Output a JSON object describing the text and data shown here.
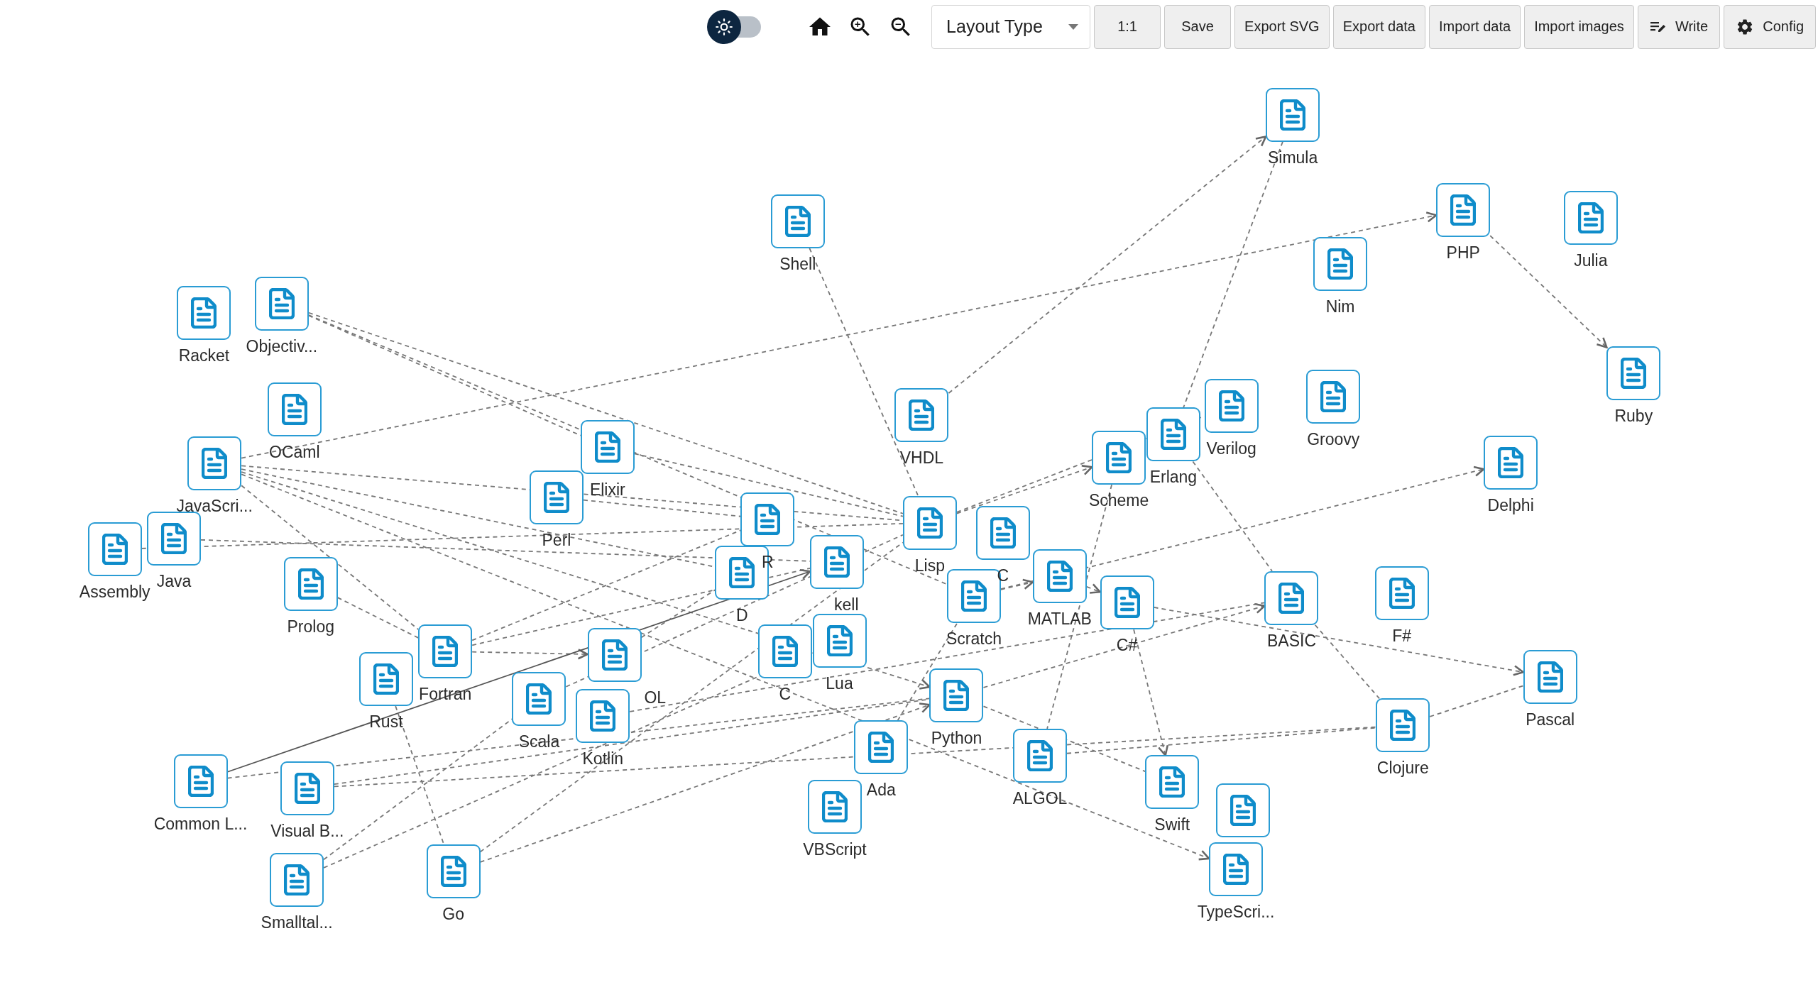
{
  "toolbar": {
    "theme_toggle": {
      "on": false
    },
    "layout_select": {
      "value": "Layout Type"
    },
    "buttons": [
      {
        "label": "1:1",
        "kind": "text"
      },
      {
        "label": "Save",
        "kind": "text"
      },
      {
        "label": "Export SVG",
        "kind": "text"
      },
      {
        "label": "Export data",
        "kind": "text"
      },
      {
        "label": "Import data",
        "kind": "text"
      },
      {
        "label": "Import images",
        "kind": "text"
      },
      {
        "label": "Write",
        "kind": "write"
      },
      {
        "label": "Config",
        "kind": "config"
      }
    ]
  },
  "graph": {
    "nodes": [
      {
        "kind": "document",
        "label": "Simula"
      },
      {
        "kind": "document",
        "label": "Shell"
      },
      {
        "kind": "document",
        "label": "PHP"
      },
      {
        "kind": "document",
        "label": "Julia"
      },
      {
        "kind": "document",
        "label": "Nim"
      },
      {
        "kind": "document",
        "label": "Racket"
      },
      {
        "kind": "document",
        "label": "Objectiv..."
      },
      {
        "kind": "document",
        "label": "Ruby"
      },
      {
        "kind": "document",
        "label": "OCaml"
      },
      {
        "kind": "document",
        "label": "VHDL"
      },
      {
        "kind": "document",
        "label": "Groovy"
      },
      {
        "kind": "document",
        "label": "Verilog"
      },
      {
        "kind": "document",
        "label": "Scheme"
      },
      {
        "kind": "document",
        "label": "Erlang"
      },
      {
        "kind": "document",
        "label": "Delphi"
      },
      {
        "kind": "document",
        "label": "Elixir"
      },
      {
        "kind": "document",
        "label": "Perl"
      },
      {
        "kind": "document",
        "label": "Java"
      },
      {
        "kind": "document",
        "label": "JavaScri..."
      },
      {
        "kind": "document",
        "label": "Assembly"
      },
      {
        "kind": "document",
        "label": "R"
      },
      {
        "kind": "document",
        "label": "Lisp"
      },
      {
        "kind": "document",
        "label": "D"
      },
      {
        "kind": "document",
        "label": "kell"
      },
      {
        "kind": "document",
        "label": "C"
      },
      {
        "kind": "document",
        "label": "Scratch"
      },
      {
        "kind": "document",
        "label": "MATLAB"
      },
      {
        "kind": "document",
        "label": "C#"
      },
      {
        "kind": "document",
        "label": "Prolog"
      },
      {
        "kind": "document",
        "label": "BASIC"
      },
      {
        "kind": "document",
        "label": "F#"
      },
      {
        "kind": "document",
        "label": "C"
      },
      {
        "kind": "document",
        "label": "Lua"
      },
      {
        "kind": "document",
        "label": "Fortran"
      },
      {
        "kind": "document",
        "label": "Rust"
      },
      {
        "kind": "document",
        "label": "OL"
      },
      {
        "kind": "document",
        "label": "Scala"
      },
      {
        "kind": "document",
        "label": "Kotlin"
      },
      {
        "kind": "document",
        "label": "Python"
      },
      {
        "kind": "document",
        "label": "Pascal"
      },
      {
        "kind": "document",
        "label": "Clojure"
      },
      {
        "kind": "document",
        "label": "Common L..."
      },
      {
        "kind": "document",
        "label": "Visual B..."
      },
      {
        "kind": "document",
        "label": "ALGOL"
      },
      {
        "kind": "document",
        "label": "Ada"
      },
      {
        "kind": "document",
        "label": "VBScript"
      },
      {
        "kind": "document",
        "label": "Swift"
      },
      {
        "kind": "document"
      },
      {
        "kind": "document",
        "label": "TypeScri..."
      },
      {
        "kind": "document",
        "label": "Smalltal..."
      },
      {
        "kind": "document",
        "label": "Go"
      }
    ]
  }
}
